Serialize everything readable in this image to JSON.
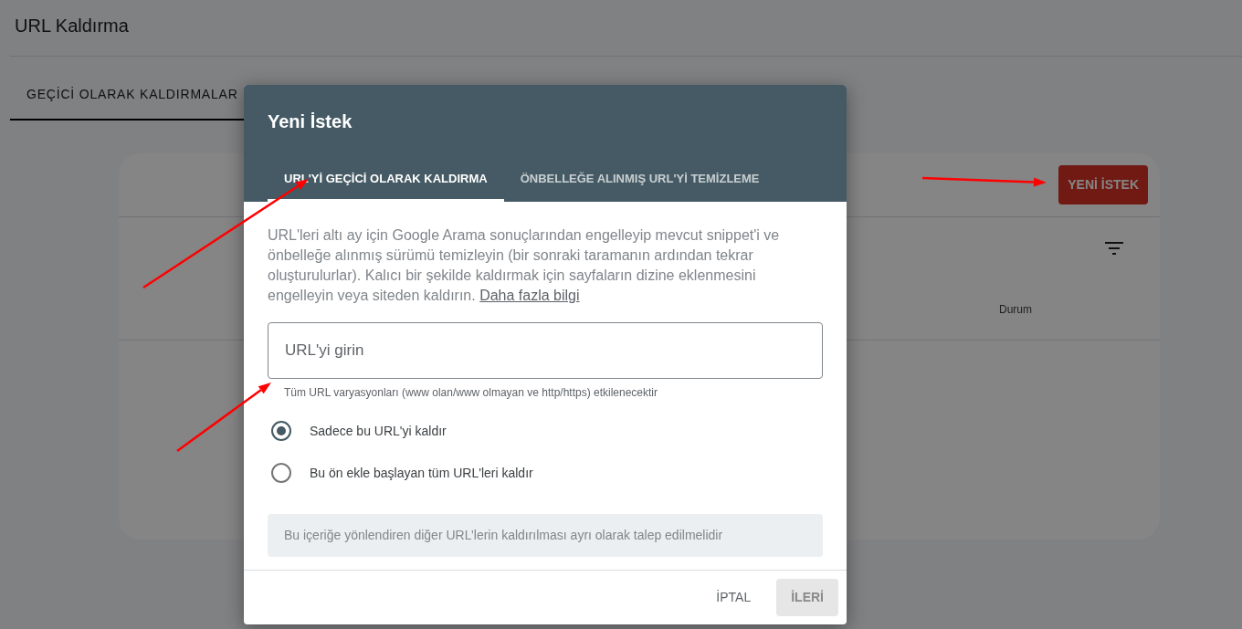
{
  "page": {
    "title": "URL Kaldırma"
  },
  "tabs": [
    {
      "label": "GEÇİCİ OLARAK KALDIRMALAR",
      "selected": true
    }
  ],
  "card": {
    "button": "YENİ İSTEK",
    "columns": [
      {
        "label": "Durum"
      }
    ]
  },
  "dialog": {
    "title": "Yeni İstek",
    "tabs": [
      {
        "label": "URL'Yİ GEÇİCİ OLARAK KALDIRMA",
        "selected": true
      },
      {
        "label": "ÖNBELLEĞE ALINMIŞ URL'Yİ TEMİZLEME",
        "selected": false
      }
    ],
    "description": "URL'leri altı ay için Google Arama sonuçlarından engelleyip mevcut snippet'i ve önbelleğe alınmış sürümü temizleyin (bir sonraki taramanın ardından tekrar oluşturulurlar). Kalıcı bir şekilde kaldırmak için sayfaların dizine eklenmesini engelleyin veya siteden kaldırın.",
    "link": "Daha fazla bilgi",
    "url_field": {
      "placeholder": "URL'yi girin"
    },
    "helper": "Tüm URL varyasyonları (www olan/www olmayan ve http/https) etkilenecektir",
    "options": [
      {
        "label": "Sadece bu URL'yi kaldır",
        "selected": true
      },
      {
        "label": "Bu ön ekle başlayan tüm URL'leri kaldır",
        "selected": false
      }
    ],
    "note": "Bu içeriğe yönlendiren diğer URL’lerin kaldırılması ayrı olarak talep edilmelidir",
    "buttons": [
      {
        "label": "İPTAL",
        "kind": "text",
        "disabled": false
      },
      {
        "label": "İLERİ",
        "kind": "filled",
        "disabled": true
      }
    ]
  }
}
